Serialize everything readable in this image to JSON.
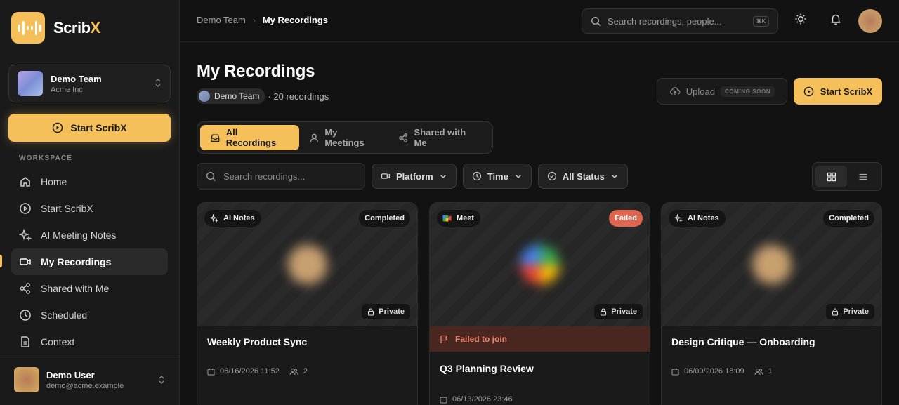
{
  "app": {
    "name_main": "Scrib",
    "name_accent": "X"
  },
  "team": {
    "name": "Demo Team",
    "org": "Acme Inc"
  },
  "sidebar": {
    "start_label": "Start ScribX",
    "workspace_label": "WORKSPACE",
    "items": [
      {
        "label": "Home",
        "icon": "home-icon"
      },
      {
        "label": "Start ScribX",
        "icon": "play-circle-icon"
      },
      {
        "label": "AI Meeting Notes",
        "icon": "sparkles-icon"
      },
      {
        "label": "My Recordings",
        "icon": "video-icon",
        "active": true
      },
      {
        "label": "Shared with Me",
        "icon": "share-icon"
      },
      {
        "label": "Scheduled",
        "icon": "clock-icon"
      },
      {
        "label": "Context",
        "icon": "document-icon"
      }
    ]
  },
  "user": {
    "name": "Demo User",
    "email": "demo@acme.example"
  },
  "topbar": {
    "breadcrumb": [
      "Demo Team",
      "My Recordings"
    ],
    "search_placeholder": "Search recordings, people...",
    "shortcut": "⌘K"
  },
  "main": {
    "title": "My Recordings",
    "team_chip": "Demo Team",
    "count_text": "· 20 recordings",
    "upload_label": "Upload",
    "upload_badge": "COMING SOON",
    "start_label": "Start ScribX",
    "tabs": [
      {
        "label": "All Recordings",
        "active": true
      },
      {
        "label": "My Meetings"
      },
      {
        "label": "Shared with Me"
      }
    ],
    "filter_search_placeholder": "Search recordings...",
    "filters": [
      "Platform",
      "Time",
      "All Status"
    ]
  },
  "cards": [
    {
      "source": "AI Notes",
      "status": "Completed",
      "privacy": "Private",
      "title": "Weekly Product Sync",
      "date": "06/16/2026 11:52",
      "participants": "2"
    },
    {
      "source": "Meet",
      "status": "Failed",
      "privacy": "Private",
      "failure": "Failed to join",
      "title": "Q3 Planning Review",
      "date": "06/13/2026 23:46"
    },
    {
      "source": "AI Notes",
      "status": "Completed",
      "privacy": "Private",
      "title": "Design Critique — Onboarding",
      "date": "06/09/2026 18:09",
      "participants": "1"
    }
  ],
  "colors": {
    "accent": "#f5c05a",
    "failed": "#e06650",
    "background": "#121212"
  }
}
